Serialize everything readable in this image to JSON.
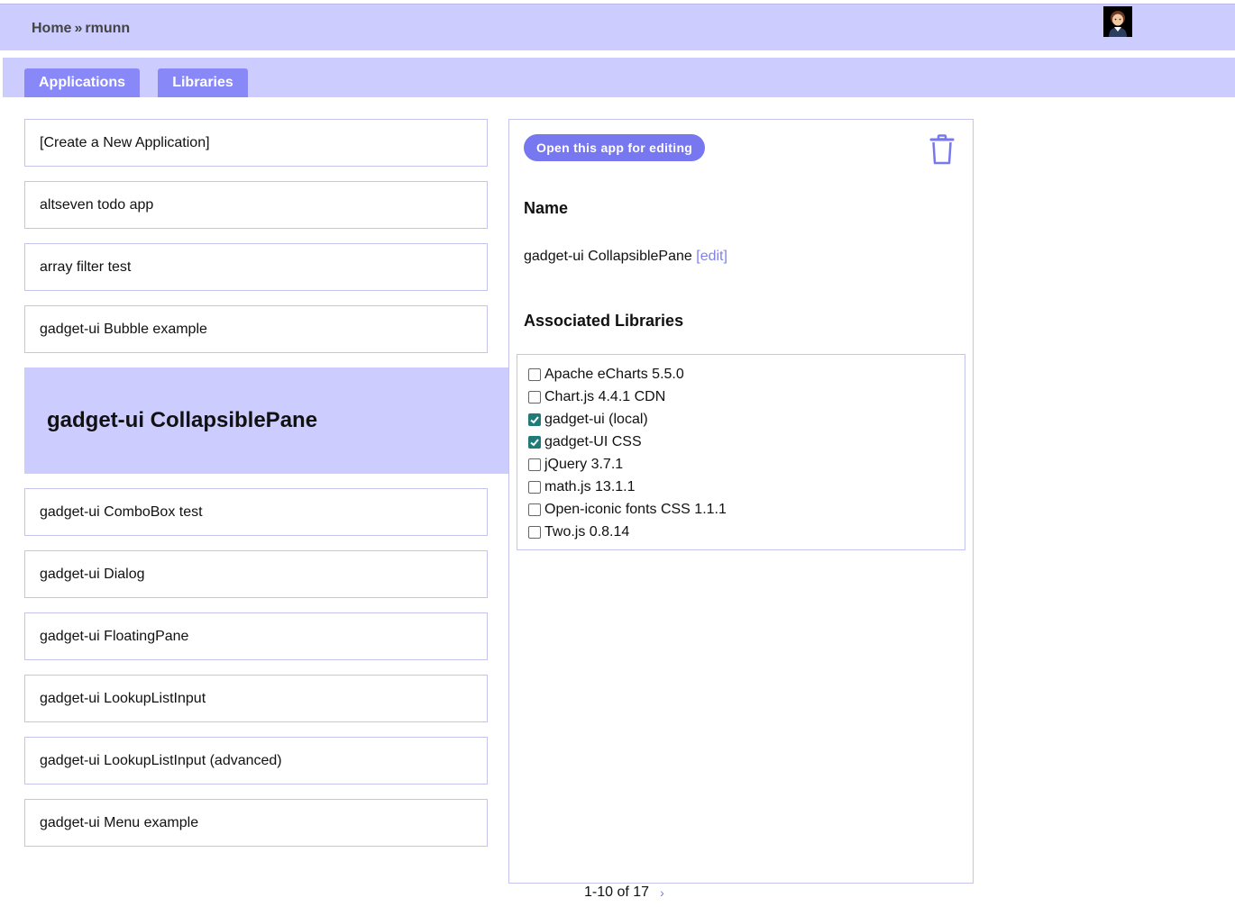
{
  "header": {
    "breadcrumb_home": "Home",
    "breadcrumb_sep": "»",
    "breadcrumb_user": "rmunn"
  },
  "tabs": {
    "applications": "Applications",
    "libraries": "Libraries"
  },
  "apps": [
    "[Create a New Application]",
    "altseven todo app",
    "array filter test",
    "gadget-ui Bubble example",
    "gadget-ui CollapsiblePane",
    "gadget-ui ComboBox test",
    "gadget-ui Dialog",
    "gadget-ui FloatingPane",
    "gadget-ui LookupListInput",
    "gadget-ui LookupListInput (advanced)",
    "gadget-ui Menu example"
  ],
  "detail": {
    "open_button": "Open this app for editing",
    "name_heading": "Name",
    "name_value": "gadget-ui CollapsiblePane",
    "edit_link": "[edit]",
    "libs_heading": "Associated Libraries",
    "libraries": [
      {
        "label": "Apache eCharts 5.5.0",
        "checked": false
      },
      {
        "label": "Chart.js 4.4.1 CDN",
        "checked": false
      },
      {
        "label": "gadget-ui (local)",
        "checked": true
      },
      {
        "label": "gadget-UI CSS",
        "checked": true
      },
      {
        "label": "jQuery 3.7.1",
        "checked": false
      },
      {
        "label": "math.js 13.1.1",
        "checked": false
      },
      {
        "label": "Open-iconic fonts CSS 1.1.1",
        "checked": false
      },
      {
        "label": "Two.js 0.8.14",
        "checked": false
      }
    ]
  },
  "pager": {
    "text": "1-10 of 17",
    "next": "›"
  },
  "colors": {
    "bar": "#ccccff",
    "accent": "#7777f0",
    "checked": "#1f7a78"
  }
}
